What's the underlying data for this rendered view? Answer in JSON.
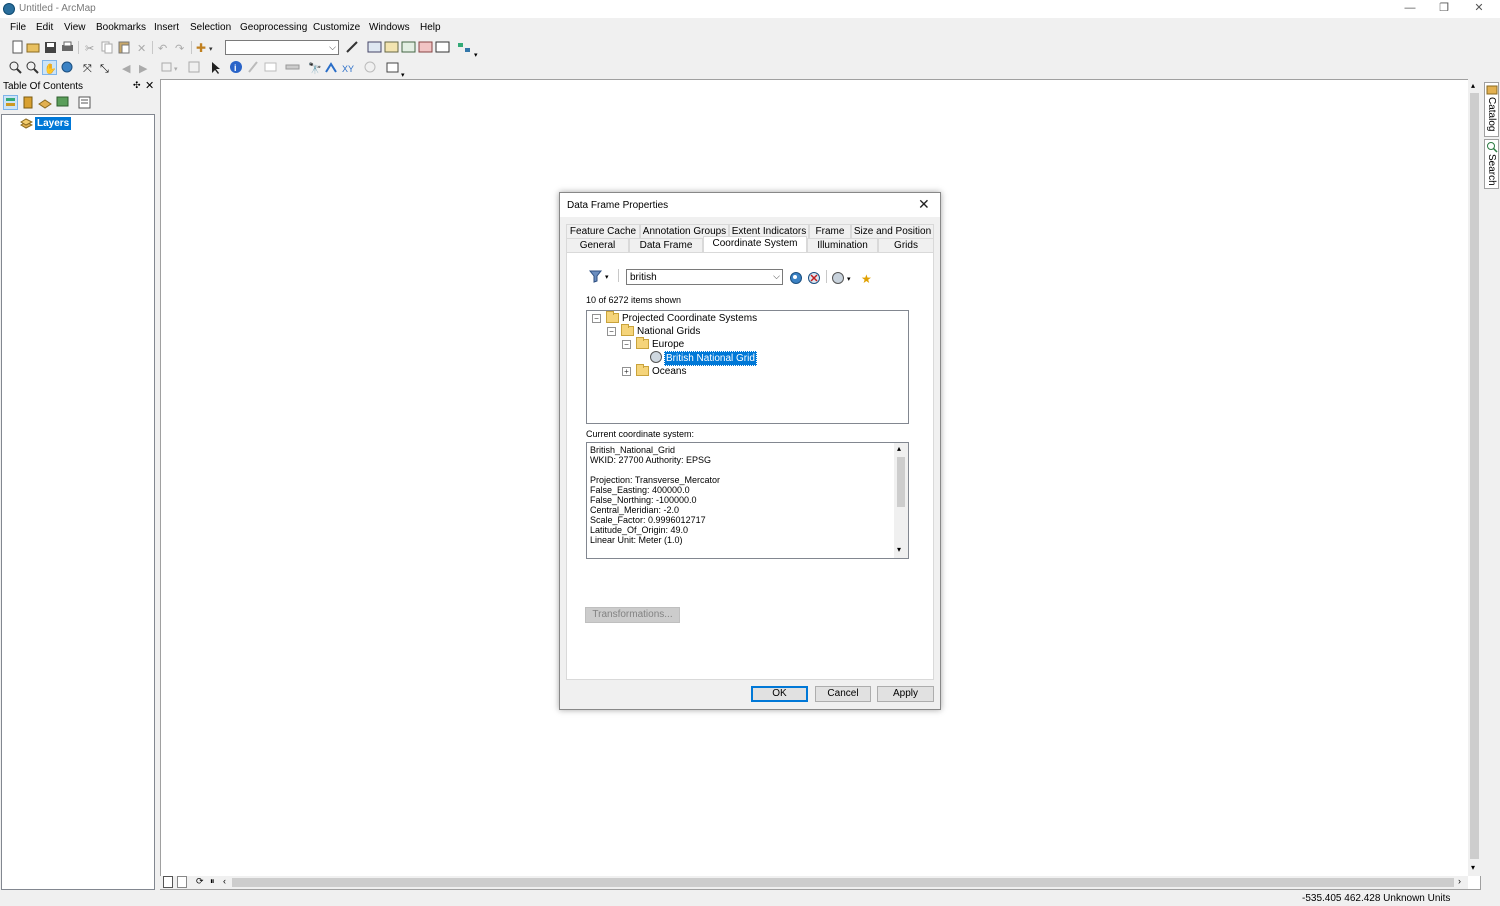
{
  "window": {
    "title": "Untitled - ArcMap",
    "min": "—",
    "restore": "❐",
    "close": "✕"
  },
  "menu": [
    "File",
    "Edit",
    "View",
    "Bookmarks",
    "Insert",
    "Selection",
    "Geoprocessing",
    "Customize",
    "Windows",
    "Help"
  ],
  "toc": {
    "title": "Table Of Contents",
    "pin": "✣",
    "close": "✕",
    "root_label": "Layers"
  },
  "right_dock": {
    "catalog": "Catalog",
    "search": "Search"
  },
  "status": {
    "coords": "-535.405  462.428 Unknown Units"
  },
  "dialog": {
    "title": "Data Frame Properties",
    "close": "✕",
    "tabs_row1": [
      "Feature Cache",
      "Annotation Groups",
      "Extent Indicators",
      "Frame",
      "Size and Position"
    ],
    "tabs_row2": [
      "General",
      "Data Frame",
      "Coordinate System",
      "Illumination",
      "Grids"
    ],
    "active_tab": "Coordinate System",
    "search_value": "british",
    "items_shown": "10 of 6272 items shown",
    "tree": [
      {
        "label": "Projected Coordinate Systems",
        "expander": "−"
      },
      {
        "label": "National Grids",
        "expander": "−"
      },
      {
        "label": "Europe",
        "expander": "−"
      },
      {
        "label": "British National Grid",
        "expander": "",
        "selected": true
      },
      {
        "label": "Oceans",
        "expander": "+"
      }
    ],
    "current_label": "Current coordinate system:",
    "current_lines": [
      "British_National_Grid",
      "WKID: 27700 Authority: EPSG",
      "",
      "Projection: Transverse_Mercator",
      "False_Easting: 400000.0",
      "False_Northing: -100000.0",
      "Central_Meridian: -2.0",
      "Scale_Factor: 0.9996012717",
      "Latitude_Of_Origin: 49.0",
      "Linear Unit: Meter (1.0)"
    ],
    "transformations_label": "Transformations...",
    "ok_label": "OK",
    "cancel_label": "Cancel",
    "apply_label": "Apply"
  },
  "colors": {
    "selection": "#0078d7",
    "chrome": "#f0f0f0"
  }
}
